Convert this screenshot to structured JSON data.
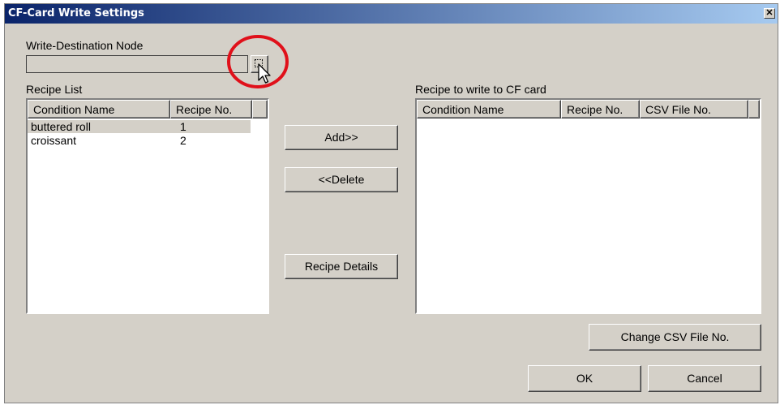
{
  "window": {
    "title": "CF-Card Write Settings",
    "close_glyph": "✕"
  },
  "node": {
    "label": "Write-Destination Node",
    "value": ""
  },
  "recipe_list": {
    "label": "Recipe List",
    "columns": [
      "Condition Name",
      "Recipe No."
    ],
    "rows": [
      {
        "name": "buttered roll",
        "no": "1",
        "selected": true
      },
      {
        "name": "croissant",
        "no": "2",
        "selected": false
      }
    ]
  },
  "buttons": {
    "add": "Add>>",
    "delete": "<<Delete",
    "details": "Recipe Details",
    "change_csv": "Change CSV File No.",
    "ok": "OK",
    "cancel": "Cancel"
  },
  "write_list": {
    "label": "Recipe to write to CF card",
    "columns": [
      "Condition Name",
      "Recipe No.",
      "CSV File No."
    ],
    "rows": []
  },
  "annotation": {
    "highlight_color": "#e0101a",
    "cursor_icon": "arrow-cursor-icon"
  }
}
